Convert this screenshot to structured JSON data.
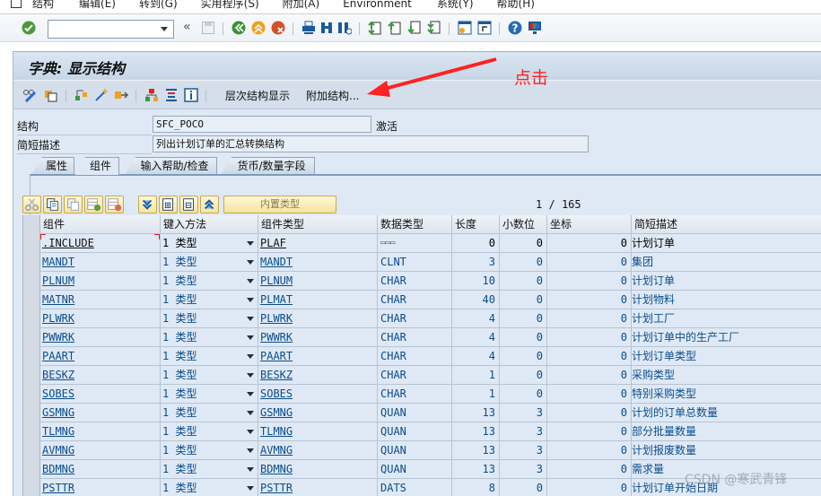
{
  "menubar": {
    "items": [
      "结构",
      "编辑(E)",
      "转到(G)",
      "实用程序(S)",
      "附加(A)",
      "Environment",
      "系统(Y)",
      "帮助(H)"
    ]
  },
  "systoolbar": {
    "okcode_value": "",
    "icons": [
      "enter-icon",
      "save-icon",
      "back-icon",
      "exit-icon",
      "cancel-icon",
      "print-icon",
      "find-icon",
      "find-next-icon",
      "first-page-icon",
      "previous-page-icon",
      "next-page-icon",
      "last-page-icon",
      "new-session-icon",
      "shortcut-icon",
      "help-icon",
      "customize-layout-icon"
    ]
  },
  "title": "字典: 显示结构",
  "apptoolbar": {
    "hierarchy_label": "层次结构显示",
    "append_label": "附加结构..."
  },
  "header": {
    "structure_label": "结构",
    "structure_value": "SFC_POCO",
    "status": "激活",
    "short_desc_label": "简短描述",
    "short_desc_value": "列出计划订单的汇总转换结构"
  },
  "tabs": [
    {
      "label": "属性",
      "active": false
    },
    {
      "label": "组件",
      "active": true
    },
    {
      "label": "输入帮助/检查",
      "active": false
    },
    {
      "label": "货币/数量字段",
      "active": false
    }
  ],
  "grid_toolbar": {
    "builtin_type_label": "内置类型",
    "page_current": "1",
    "page_sep": "/",
    "page_total": "165"
  },
  "table": {
    "columns": [
      "组件",
      "键入方法",
      "组件类型",
      "数据类型",
      "长度",
      "小数位",
      "坐标",
      "简短描述"
    ],
    "rows": [
      {
        "component": ".INCLUDE",
        "method": "1 类型",
        "comp_type": "PLAF",
        "data_type": "▭▭▭",
        "length": "0",
        "decimals": "0",
        "coord": "0",
        "desc": "计划订单"
      },
      {
        "component": "MANDT",
        "method": "1 类型",
        "comp_type": "MANDT",
        "data_type": "CLNT",
        "length": "3",
        "decimals": "0",
        "coord": "0",
        "desc": "集团"
      },
      {
        "component": "PLNUM",
        "method": "1 类型",
        "comp_type": "PLNUM",
        "data_type": "CHAR",
        "length": "10",
        "decimals": "0",
        "coord": "0",
        "desc": "计划订单"
      },
      {
        "component": "MATNR",
        "method": "1 类型",
        "comp_type": "PLMAT",
        "data_type": "CHAR",
        "length": "40",
        "decimals": "0",
        "coord": "0",
        "desc": "计划物料"
      },
      {
        "component": "PLWRK",
        "method": "1 类型",
        "comp_type": "PLWRK",
        "data_type": "CHAR",
        "length": "4",
        "decimals": "0",
        "coord": "0",
        "desc": "计划工厂"
      },
      {
        "component": "PWWRK",
        "method": "1 类型",
        "comp_type": "PWWRK",
        "data_type": "CHAR",
        "length": "4",
        "decimals": "0",
        "coord": "0",
        "desc": "计划订单中的生产工厂"
      },
      {
        "component": "PAART",
        "method": "1 类型",
        "comp_type": "PAART",
        "data_type": "CHAR",
        "length": "4",
        "decimals": "0",
        "coord": "0",
        "desc": "计划订单类型"
      },
      {
        "component": "BESKZ",
        "method": "1 类型",
        "comp_type": "BESKZ",
        "data_type": "CHAR",
        "length": "1",
        "decimals": "0",
        "coord": "0",
        "desc": "采购类型"
      },
      {
        "component": "SOBES",
        "method": "1 类型",
        "comp_type": "SOBES",
        "data_type": "CHAR",
        "length": "1",
        "decimals": "0",
        "coord": "0",
        "desc": "特别采购类型"
      },
      {
        "component": "GSMNG",
        "method": "1 类型",
        "comp_type": "GSMNG",
        "data_type": "QUAN",
        "length": "13",
        "decimals": "3",
        "coord": "0",
        "desc": "计划的订单总数量"
      },
      {
        "component": "TLMNG",
        "method": "1 类型",
        "comp_type": "TLMNG",
        "data_type": "QUAN",
        "length": "13",
        "decimals": "3",
        "coord": "0",
        "desc": "部分批量数量"
      },
      {
        "component": "AVMNG",
        "method": "1 类型",
        "comp_type": "AVMNG",
        "data_type": "QUAN",
        "length": "13",
        "decimals": "3",
        "coord": "0",
        "desc": "计划报废数量"
      },
      {
        "component": "BDMNG",
        "method": "1 类型",
        "comp_type": "BDMNG",
        "data_type": "QUAN",
        "length": "13",
        "decimals": "3",
        "coord": "0",
        "desc": "需求量"
      },
      {
        "component": "PSTTR",
        "method": "1 类型",
        "comp_type": "PSTTR",
        "data_type": "DATS",
        "length": "8",
        "decimals": "0",
        "coord": "0",
        "desc": "计划订单开始日期"
      }
    ]
  },
  "annotation": {
    "text": "点击",
    "color": "#ff2222"
  },
  "watermark": "CSDN @寒武青锋"
}
